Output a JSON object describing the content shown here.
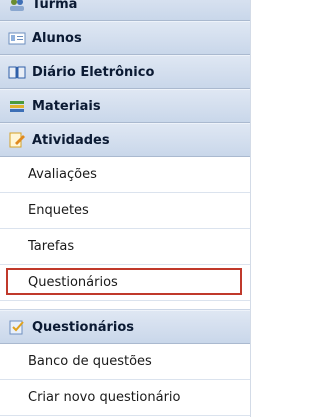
{
  "menu": {
    "turma": "Turma",
    "alunos": "Alunos",
    "diario": "Diário Eletrônico",
    "materiais": "Materiais",
    "atividades": "Atividades",
    "atividades_items": [
      "Avaliações",
      "Enquetes",
      "Tarefas",
      "Questionários"
    ],
    "questionarios": "Questionários",
    "questionarios_items": [
      "Banco de questões",
      "Criar novo questionário"
    ]
  },
  "colors": {
    "header_bg": "#c9d7ea",
    "highlight_border": "#c0392b"
  },
  "icons": [
    "group-icon",
    "students-icon",
    "book-icon",
    "stack-icon",
    "edit-note-icon",
    "quiz-icon"
  ]
}
